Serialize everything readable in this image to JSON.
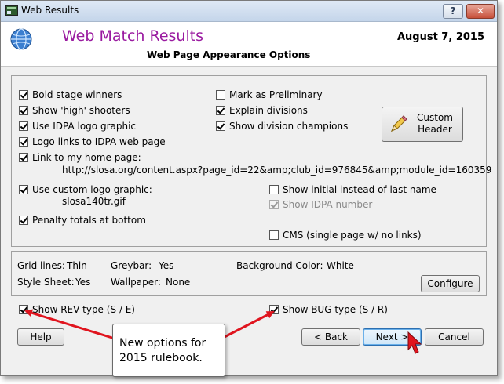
{
  "window": {
    "title": "Web Results"
  },
  "titlebar": {
    "help_label": "?",
    "close_label": "✕"
  },
  "header": {
    "title": "Web Match Results",
    "date": "August  7, 2015",
    "subtitle": "Web Page Appearance Options"
  },
  "options_left": [
    {
      "label": "Bold stage winners",
      "checked": true
    },
    {
      "label": "Show  'high' shooters",
      "checked": true
    },
    {
      "label": "Use IDPA logo graphic",
      "checked": true
    },
    {
      "label": "Logo links to IDPA web page",
      "checked": true
    },
    {
      "label": "Link to my home page:",
      "checked": true
    },
    {
      "label": "Use custom logo graphic:",
      "checked": true
    },
    {
      "label": "Penalty totals at bottom",
      "checked": true
    }
  ],
  "home_page_url": "http://slosa.org/content.aspx?page_id=22&amp;club_id=976845&amp;module_id=160359",
  "custom_logo_file": "slosa140tr.gif",
  "options_right": [
    {
      "label": "Mark as Preliminary",
      "checked": false
    },
    {
      "label": "Explain divisions",
      "checked": true
    },
    {
      "label": "Show division champions",
      "checked": true
    },
    {
      "label": "Show initial instead of last name",
      "checked": false
    },
    {
      "label": "Show IDPA number",
      "checked": true,
      "disabled": true
    },
    {
      "label": "CMS (single page w/ no links)",
      "checked": false
    }
  ],
  "custom_header_button": {
    "line1": "Custom",
    "line2": "Header"
  },
  "grid_settings": {
    "grid_lines_label": "Grid lines:",
    "grid_lines_value": "Thin",
    "greybar_label": "Greybar:",
    "greybar_value": "Yes",
    "background_label": "Background Color:",
    "background_value": "White",
    "stylesheet_label": "Style Sheet:",
    "stylesheet_value": "Yes",
    "wallpaper_label": "Wallpaper:",
    "wallpaper_value": "None",
    "configure_label": "Configure"
  },
  "type_options": [
    {
      "label": "Show REV type (S / E)",
      "checked": true
    },
    {
      "label": "Show BUG type (S / R)",
      "checked": true
    }
  ],
  "buttons": {
    "help": "Help",
    "back": "< Back",
    "next": "Next >",
    "cancel": "Cancel"
  },
  "callout": {
    "line1": "New options for",
    "line2": "2015 rulebook."
  },
  "colors": {
    "title_accent": "#9a1aa0",
    "arrow": "#e0141e"
  }
}
